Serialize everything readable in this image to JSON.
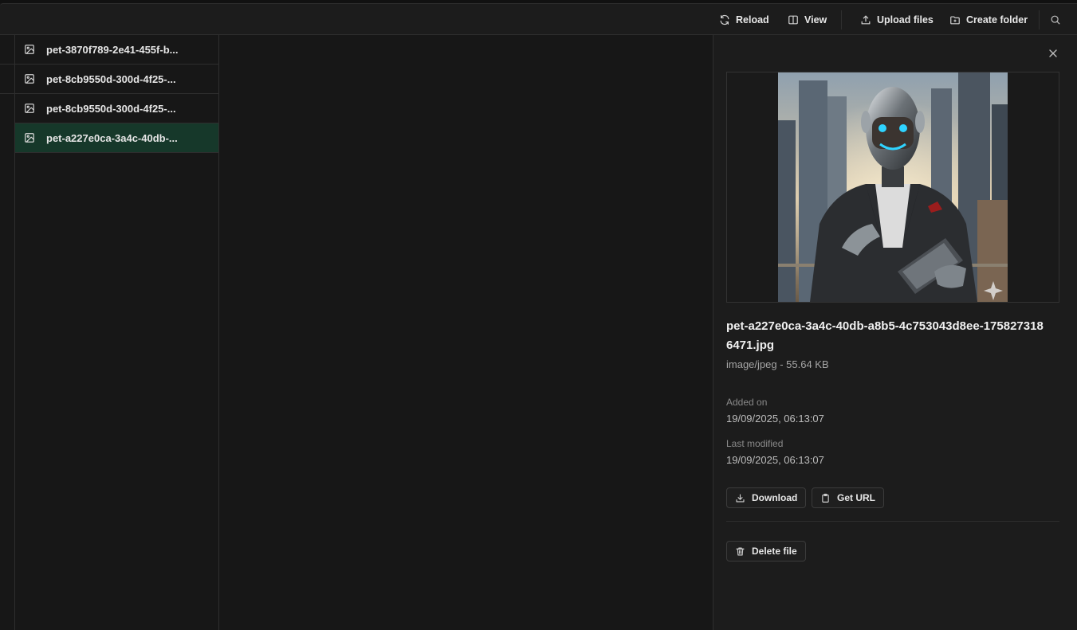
{
  "toolbar": {
    "reload_label": "Reload",
    "view_label": "View",
    "upload_label": "Upload files",
    "create_folder_label": "Create folder"
  },
  "files": [
    {
      "name": "pet-3870f789-2e41-455f-b...",
      "selected": false
    },
    {
      "name": "pet-8cb9550d-300d-4f25-...",
      "selected": false
    },
    {
      "name": "pet-8cb9550d-300d-4f25-...",
      "selected": false
    },
    {
      "name": "pet-a227e0ca-3a4c-40db-...",
      "selected": true
    }
  ],
  "details": {
    "file_name": "pet-a227e0ca-3a4c-40db-a8b5-4c753043d8ee-1758273186471.jpg",
    "file_meta": "image/jpeg - 55.64 KB",
    "added_label": "Added on",
    "added_value": "19/09/2025, 06:13:07",
    "modified_label": "Last modified",
    "modified_value": "19/09/2025, 06:13:07",
    "download_label": "Download",
    "get_url_label": "Get URL",
    "delete_label": "Delete file"
  },
  "colors": {
    "selected_row": "#16382a",
    "background": "#171717",
    "panel": "#1c1c1c"
  }
}
